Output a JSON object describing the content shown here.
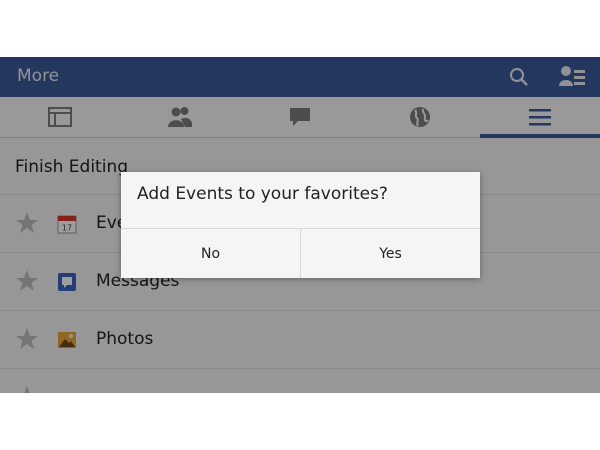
{
  "titlebar": {
    "title": "More",
    "search_icon": "search-icon",
    "friends_icon": "friend-requests-icon"
  },
  "tabs": [
    {
      "icon": "news-feed-icon",
      "active": false
    },
    {
      "icon": "friends-icon",
      "active": false
    },
    {
      "icon": "messages-icon",
      "active": false
    },
    {
      "icon": "notifications-globe-icon",
      "active": false
    },
    {
      "icon": "menu-icon",
      "active": true
    }
  ],
  "finish_editing": "Finish Editing",
  "list": [
    {
      "label": "Events",
      "icon": "calendar-icon",
      "calendar_day": "17"
    },
    {
      "label": "Messages",
      "icon": "messages-app-icon"
    },
    {
      "label": "Photos",
      "icon": "photos-app-icon"
    }
  ],
  "dialog": {
    "message": "Add Events to your favorites?",
    "no_label": "No",
    "yes_label": "Yes"
  },
  "colors": {
    "brand": "#3b5998",
    "dim_overlay": "rgba(0,0,0,0.38)"
  }
}
